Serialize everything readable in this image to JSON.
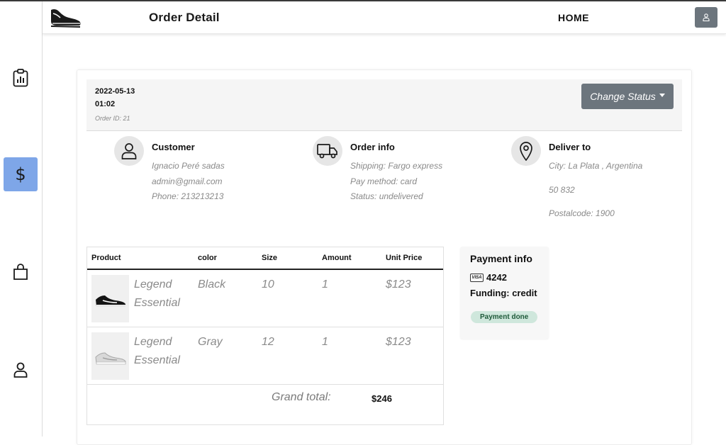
{
  "header": {
    "title": "Order Detail",
    "home_label": "HOME"
  },
  "sidebar": {
    "items": [
      {
        "icon": "clipboard-chart-icon"
      },
      {
        "icon": "dollar-icon",
        "label": "$",
        "active": true
      },
      {
        "icon": "shopping-bag-icon"
      },
      {
        "icon": "user-icon"
      }
    ],
    "active_color": "#7ea6e8"
  },
  "order": {
    "date": "2022-05-13",
    "time": "01:02",
    "id_label": "Order ID: 21",
    "status_button": "Change Status"
  },
  "customer": {
    "title": "Customer",
    "name": "Ignacio Peré sadas",
    "email": "admin@gmail.com",
    "phone": "Phone: 213213213"
  },
  "order_info": {
    "title": "Order info",
    "shipping": "Shipping: Fargo express",
    "pay_method": "Pay method: card",
    "status": "Status: undelivered"
  },
  "deliver": {
    "title": "Deliver to",
    "city": "City: La Plata , Argentina",
    "address": "50 832",
    "postal": "Postalcode: 1900"
  },
  "table": {
    "columns": [
      "Product",
      "color",
      "Size",
      "Amount",
      "Unit Price"
    ],
    "rows": [
      {
        "product_line1": "Legend",
        "product_line2": "Essential",
        "color": "Black",
        "size": "10",
        "amount": "1",
        "price": "$123"
      },
      {
        "product_line1": "Legend",
        "product_line2": "Essential",
        "color": "Gray",
        "size": "12",
        "amount": "1",
        "price": "$123"
      }
    ],
    "grand_total_label": "Grand total:",
    "grand_total_value": "$246"
  },
  "payment": {
    "title": "Payment info",
    "card_brand": "VISA",
    "last4": "4242",
    "funding": "Funding: credit",
    "badge": "Payment done",
    "badge_color": "#cfe7dc"
  }
}
